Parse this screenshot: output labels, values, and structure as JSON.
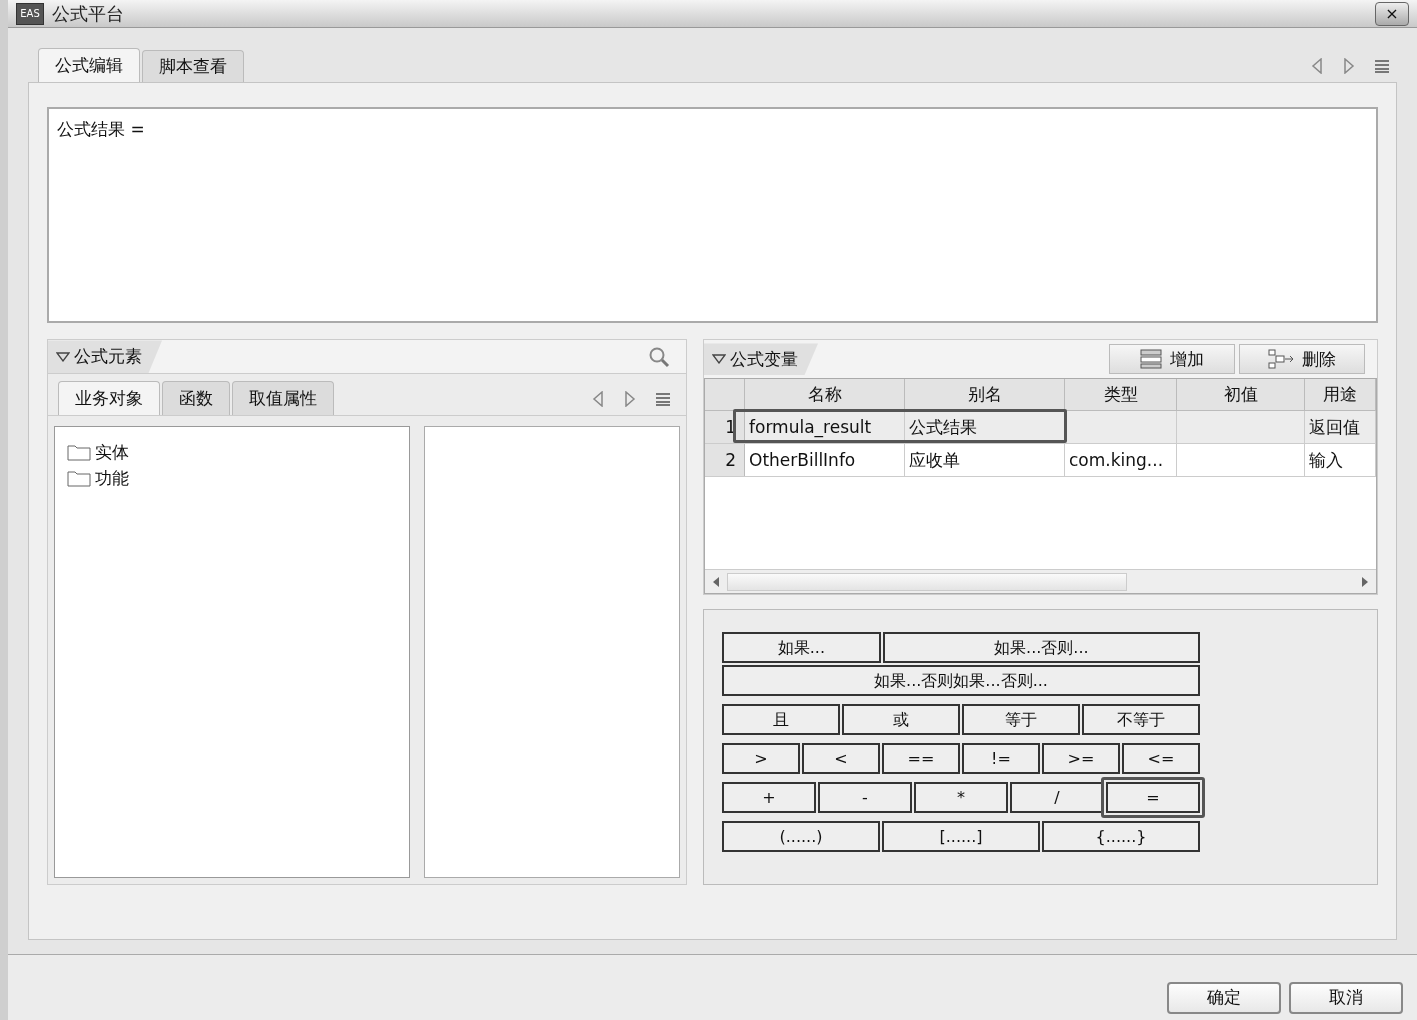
{
  "window": {
    "logo": "EAS",
    "title": "公式平台",
    "close": "×"
  },
  "tabs": [
    {
      "label": "公式编辑",
      "selected": true
    },
    {
      "label": "脚本查看",
      "selected": false
    }
  ],
  "editor": {
    "value": "公式结果 ="
  },
  "elements_panel": {
    "title": "公式元素",
    "expanded": true,
    "tabs": [
      {
        "label": "业务对象",
        "selected": true
      },
      {
        "label": "函数",
        "selected": false
      },
      {
        "label": "取值属性",
        "selected": false
      }
    ],
    "tree": [
      {
        "label": "实体"
      },
      {
        "label": "功能"
      }
    ]
  },
  "variables_panel": {
    "title": "公式变量",
    "expanded": true,
    "buttons": [
      {
        "kind": "add",
        "label": "增加"
      },
      {
        "kind": "delete",
        "label": "删除"
      }
    ],
    "table": {
      "columns": [
        "名称",
        "别名",
        "类型",
        "初值",
        "用途"
      ],
      "rows": [
        {
          "index": "1",
          "cells": [
            "formula_result",
            "公式结果",
            "",
            "",
            "返回值"
          ],
          "selected": true,
          "highlighted": true
        },
        {
          "index": "2",
          "cells": [
            "OtherBillInfo",
            "应收单",
            "com.king...",
            "",
            "输入"
          ],
          "selected": false,
          "highlighted": false
        }
      ]
    }
  },
  "operator_rows": [
    [
      {
        "label": "如果...",
        "kind": "normal",
        "highlighted": false
      },
      {
        "label": "如果...否则...",
        "kind": "wide",
        "highlighted": false
      }
    ],
    [
      {
        "label": "如果...否则如果...否则...",
        "kind": "normal",
        "highlighted": false
      }
    ],
    [
      {
        "label": "且",
        "kind": "normal",
        "highlighted": false
      },
      {
        "label": "或",
        "kind": "normal",
        "highlighted": false
      },
      {
        "label": "等于",
        "kind": "normal",
        "highlighted": false
      },
      {
        "label": "不等于",
        "kind": "normal",
        "highlighted": false
      }
    ],
    [
      {
        "label": ">",
        "kind": "normal",
        "highlighted": false
      },
      {
        "label": "<",
        "kind": "normal",
        "highlighted": false
      },
      {
        "label": "==",
        "kind": "normal",
        "highlighted": false
      },
      {
        "label": "!=",
        "kind": "normal",
        "highlighted": false
      },
      {
        "label": ">=",
        "kind": "normal",
        "highlighted": false
      },
      {
        "label": "<=",
        "kind": "normal",
        "highlighted": false
      }
    ],
    [
      {
        "label": "+",
        "kind": "normal",
        "highlighted": false
      },
      {
        "label": "-",
        "kind": "normal",
        "highlighted": false
      },
      {
        "label": "*",
        "kind": "normal",
        "highlighted": false
      },
      {
        "label": "/",
        "kind": "normal",
        "highlighted": false
      },
      {
        "label": "=",
        "kind": "normal",
        "highlighted": true
      }
    ],
    [
      {
        "label": "(......)",
        "kind": "normal",
        "highlighted": false
      },
      {
        "label": "[......]",
        "kind": "normal",
        "highlighted": false
      },
      {
        "label": "{......}",
        "kind": "normal",
        "highlighted": false
      }
    ]
  ],
  "footer_buttons": [
    "确定",
    "取消"
  ]
}
